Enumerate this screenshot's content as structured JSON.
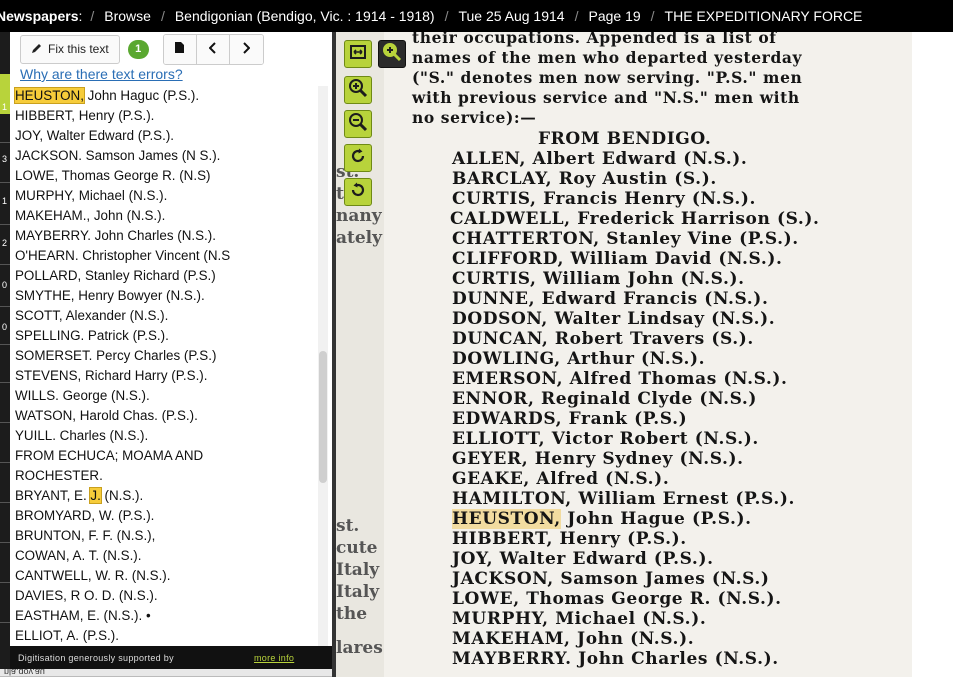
{
  "breadcrumb": {
    "root": "Newspapers",
    "items": [
      "Browse",
      "Bendigonian (Bendigo, Vic. : 1914 - 1918)",
      "Tue 25 Aug 1914",
      "Page 19",
      "THE EXPEDITIONARY FORCE"
    ]
  },
  "gutter_markers": [
    "1",
    "3",
    "1",
    "2",
    "0",
    "0"
  ],
  "toolbar": {
    "fix_label": "Fix this text",
    "corrections_count": "1"
  },
  "why_link": "Why are there text errors?",
  "ocr_lines": [
    {
      "pre": "",
      "hl": "HEUSTON,",
      "post": " John Haguc (P.S.)."
    },
    {
      "pre": "HIBBERT, Henry (P.S.).",
      "hl": "",
      "post": ""
    },
    {
      "pre": "JOY, Walter Edward (P.S.).",
      "hl": "",
      "post": ""
    },
    {
      "pre": "JACKSON. Samson James (N S.).",
      "hl": "",
      "post": ""
    },
    {
      "pre": "LOWE, Thomas George R. (N.S)",
      "hl": "",
      "post": ""
    },
    {
      "pre": "MURPHY, Michael (N.S.).",
      "hl": "",
      "post": ""
    },
    {
      "pre": "MAKEHAM., John (N.S.).",
      "hl": "",
      "post": ""
    },
    {
      "pre": "MAYBERRY. John Charles (N.S.).",
      "hl": "",
      "post": ""
    },
    {
      "pre": "O'HEARN. Christopher Vincent (N.S",
      "hl": "",
      "post": ""
    },
    {
      "pre": "POLLARD, Stanley Richard (P.S.)",
      "hl": "",
      "post": ""
    },
    {
      "pre": "SMYTHE, Henry Bowyer (N.S.).",
      "hl": "",
      "post": ""
    },
    {
      "pre": "SCOTT, Alexander (N.S.).",
      "hl": "",
      "post": ""
    },
    {
      "pre": "SPELLING. Patrick (P.S.).",
      "hl": "",
      "post": ""
    },
    {
      "pre": "SOMERSET. Percy Charles (P.S.)",
      "hl": "",
      "post": ""
    },
    {
      "pre": "STEVENS, Richard Harry (P.S.).",
      "hl": "",
      "post": ""
    },
    {
      "pre": "WILLS. George (N.S.).",
      "hl": "",
      "post": ""
    },
    {
      "pre": "WATSON, Harold Chas. (P.S.).",
      "hl": "",
      "post": ""
    },
    {
      "pre": "YUILL. Charles (N.S.).",
      "hl": "",
      "post": ""
    },
    {
      "pre": "FROM ECHUCA; MOAMA AND",
      "hl": "",
      "post": ""
    },
    {
      "pre": "ROCHESTER.",
      "hl": "",
      "post": ""
    },
    {
      "pre": "BRYANT, E. ",
      "hl": "J.",
      "post": " (N.S.)."
    },
    {
      "pre": "BROMYARD, W. (P.S.).",
      "hl": "",
      "post": ""
    },
    {
      "pre": "BRUNTON, F. F. (N.S.),",
      "hl": "",
      "post": ""
    },
    {
      "pre": "COWAN, A. T. (N.S.).",
      "hl": "",
      "post": ""
    },
    {
      "pre": "CANTWELL, W. R. (N.S.).",
      "hl": "",
      "post": ""
    },
    {
      "pre": "DAVIES, R O. D. (N.S.).",
      "hl": "",
      "post": ""
    },
    {
      "pre": "EASTHAM, E. (N.S.). •",
      "hl": "",
      "post": ""
    },
    {
      "pre": "ELLIOT, A. (P.S.).",
      "hl": "",
      "post": ""
    }
  ],
  "footer": {
    "text": "Digitisation generously supported by",
    "more": "more info"
  },
  "url_strip": "nla.gov.au",
  "viewer": {
    "prev_column_fragments": [
      "st.",
      "tw-",
      "nany",
      "ately",
      "st.",
      "cute",
      "Italy",
      "Italy",
      "the",
      "lares"
    ],
    "scan_lines": [
      {
        "pre": "their occupations.  Appended is a list of",
        "hl": "",
        "post": ""
      },
      {
        "pre": "names of the men who departed yesterday",
        "hl": "",
        "post": ""
      },
      {
        "pre": "(\"S.\" denotes men now serving.  \"P.S.\" men",
        "hl": "",
        "post": ""
      },
      {
        "pre": "with previous service and \"N.S.\" men with",
        "hl": "",
        "post": ""
      },
      {
        "pre": "no service):—",
        "hl": "",
        "post": ""
      },
      {
        "pre": "FROM BENDIGO.",
        "hl": "",
        "post": ""
      },
      {
        "pre": "ALLEN, Albert Edward (N.S.).",
        "hl": "",
        "post": ""
      },
      {
        "pre": "BARCLAY, Roy Austin (S.).",
        "hl": "",
        "post": ""
      },
      {
        "pre": "CURTIS, Francis Henry (N.S.).",
        "hl": "",
        "post": ""
      },
      {
        "pre": "CALDWELL, Frederick Harrison (S.).",
        "hl": "",
        "post": ""
      },
      {
        "pre": "CHATTERTON, Stanley Vine (P.S.).",
        "hl": "",
        "post": ""
      },
      {
        "pre": "CLIFFORD, William David (N.S.).",
        "hl": "",
        "post": ""
      },
      {
        "pre": "CURTIS, William John (N.S.).",
        "hl": "",
        "post": ""
      },
      {
        "pre": "DUNNE, Edward Francis (N.S.).",
        "hl": "",
        "post": ""
      },
      {
        "pre": "DODSON, Walter Lindsay (N.S.).",
        "hl": "",
        "post": ""
      },
      {
        "pre": "DUNCAN, Robert Travers (S.).",
        "hl": "",
        "post": ""
      },
      {
        "pre": "DOWLING, Arthur (N.S.).",
        "hl": "",
        "post": ""
      },
      {
        "pre": "EMERSON, Alfred Thomas (N.S.).",
        "hl": "",
        "post": ""
      },
      {
        "pre": "ENNOR, Reginald Clyde (N.S.)",
        "hl": "",
        "post": ""
      },
      {
        "pre": "EDWARDS, Frank (P.S.)",
        "hl": "",
        "post": ""
      },
      {
        "pre": "ELLIOTT, Victor Robert (N.S.).",
        "hl": "",
        "post": ""
      },
      {
        "pre": "GEYER, Henry Sydney (N.S.).",
        "hl": "",
        "post": ""
      },
      {
        "pre": "GEAKE, Alfred (N.S.).",
        "hl": "",
        "post": ""
      },
      {
        "pre": "HAMILTON, William Ernest (P.S.).",
        "hl": "",
        "post": ""
      },
      {
        "pre": "",
        "hl": "HEUSTON,",
        "post": " John Hague (P.S.)."
      },
      {
        "pre": "HIBBERT, Henry (P.S.).",
        "hl": "",
        "post": ""
      },
      {
        "pre": "JOY, Walter Edward (P.S.).",
        "hl": "",
        "post": ""
      },
      {
        "pre": "JACKSON, Samson James (N.S.)",
        "hl": "",
        "post": ""
      },
      {
        "pre": "LOWE, Thomas George R. (N.S.).",
        "hl": "",
        "post": ""
      },
      {
        "pre": "MURPHY, Michael (N.S.).",
        "hl": "",
        "post": ""
      },
      {
        "pre": "MAKEHAM, John (N.S.).",
        "hl": "",
        "post": ""
      },
      {
        "pre": "MAYBERRY. John Charles (N.S.).",
        "hl": "",
        "post": ""
      }
    ]
  },
  "colors": {
    "accent_green": "#b8d33b",
    "badge_green": "#5aa830",
    "highlight": "#f6cc3a",
    "link": "#2a6eb5"
  }
}
